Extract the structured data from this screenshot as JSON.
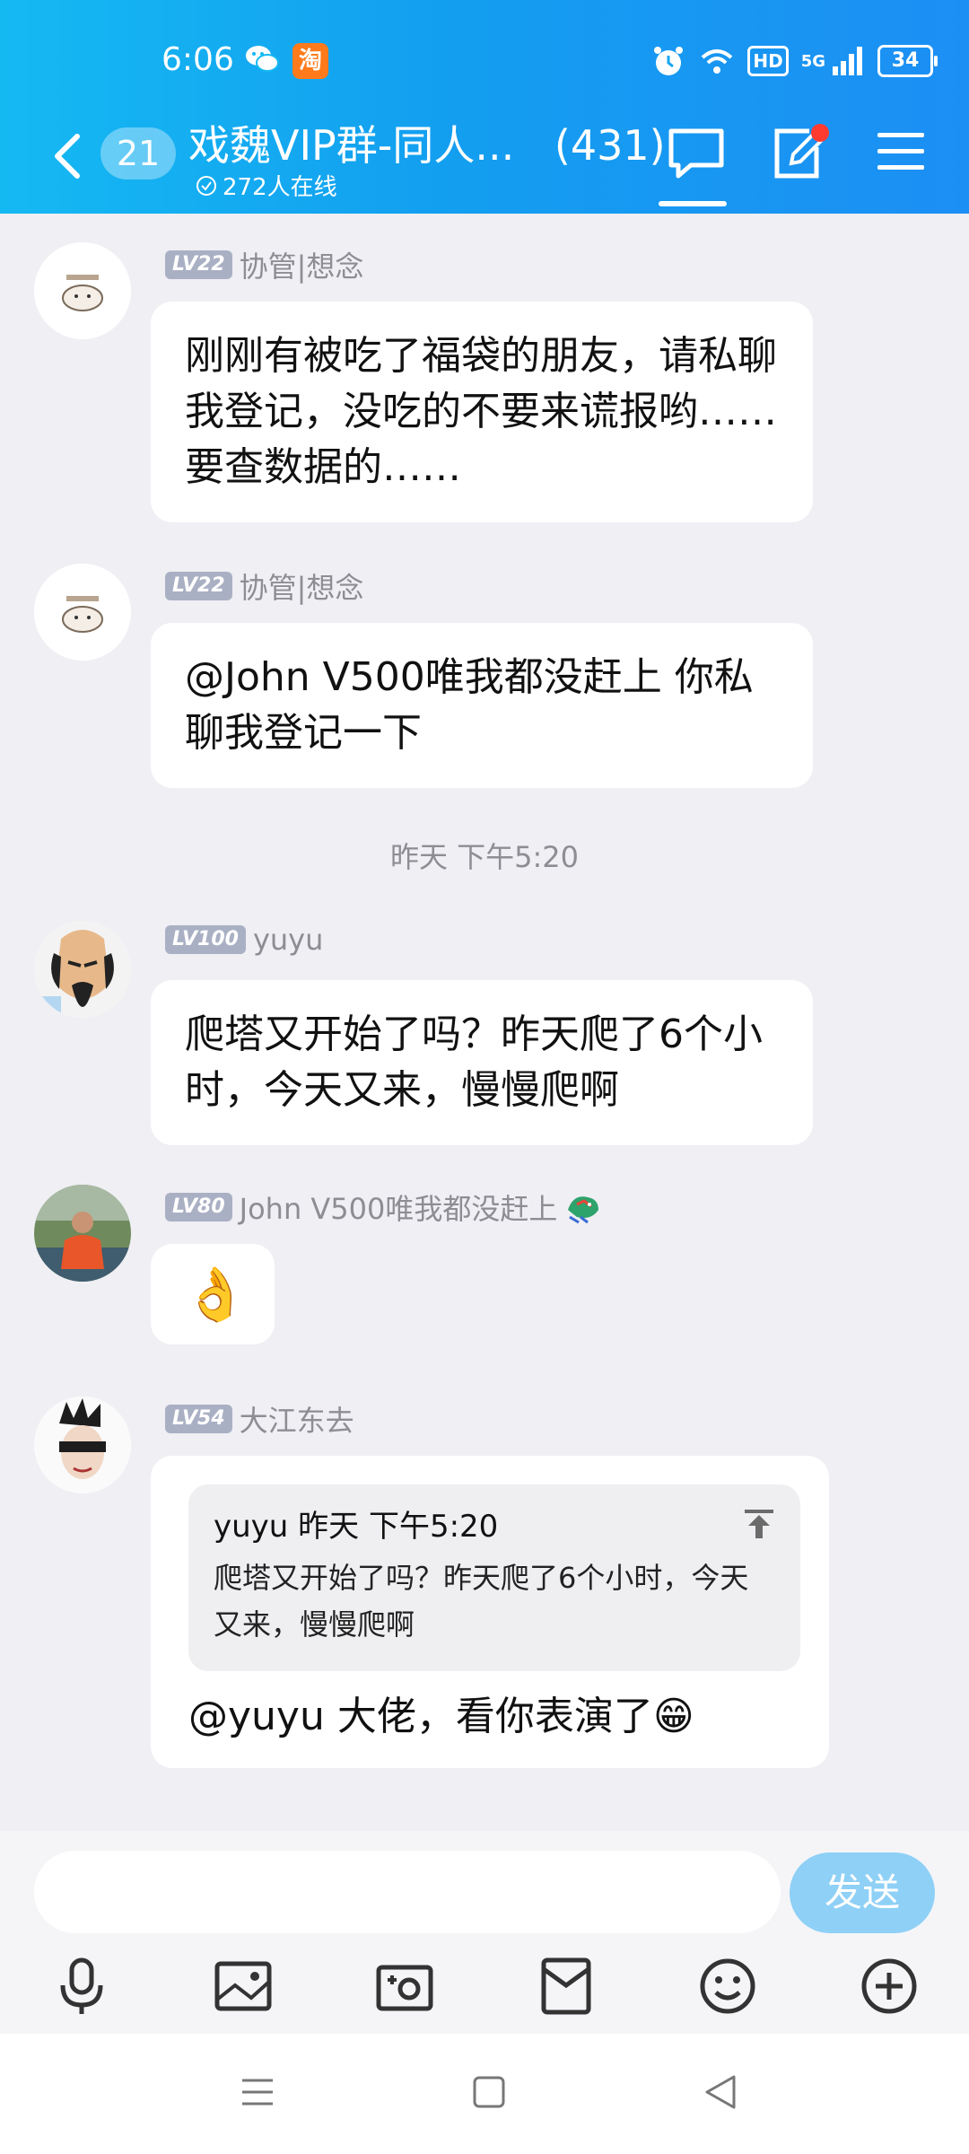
{
  "status_bar": {
    "time": "6:06",
    "taobao": "淘",
    "hd": "HD",
    "network": "5G",
    "battery": "34"
  },
  "header": {
    "unread_count": "21",
    "group_title": "戏魏VIP群-同人...",
    "member_count": "(431)",
    "online": "272人在线"
  },
  "messages": [
    {
      "level": "LV22",
      "name": "协管|想念",
      "text": "刚刚有被吃了福袋的朋友，请私聊我登记，没吃的不要来谎报哟……要查数据的……"
    },
    {
      "level": "LV22",
      "name": "协管|想念",
      "text": "@John V500唯我都没赶上 你私聊我登记一下"
    },
    {
      "timestamp": "昨天 下午5:20"
    },
    {
      "level": "LV100",
      "name": "yuyu",
      "text": "爬塔又开始了吗？昨天爬了6个小时，今天又来，慢慢爬啊"
    },
    {
      "level": "LV80",
      "name": "John V500唯我都没赶上",
      "text": "👌"
    },
    {
      "level": "LV54",
      "name": "大江东去",
      "quote_head": "yuyu 昨天 下午5:20",
      "quote_text": "爬塔又开始了吗？昨天爬了6个小时，今天又来，慢慢爬啊",
      "text": "@yuyu 大佬，看你表演了😁"
    }
  ],
  "input": {
    "placeholder": "",
    "send_label": "发送"
  },
  "colors": {
    "header_start": "#15b9f2",
    "header_end": "#1c8ff4",
    "send_button": "#8fd0f6",
    "level_badge": "#aab0c4",
    "notification_dot": "#ff3b30"
  }
}
